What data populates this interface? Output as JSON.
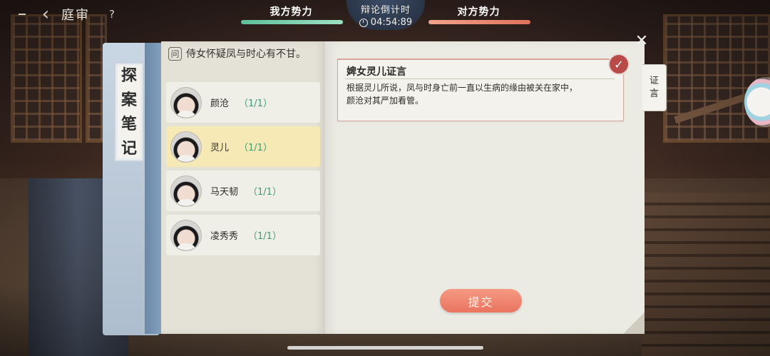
{
  "nav": {
    "page_title": "庭审",
    "help_label": "?"
  },
  "debate": {
    "our_side": "我方势力",
    "their_side": "对方势力",
    "timer_label": "辩论倒计时",
    "timer_value": "04:54:89",
    "colors": {
      "our_bar": "#6fcca6",
      "their_bar": "#e8826a"
    }
  },
  "notebook": {
    "tag_chars": [
      "探",
      "案",
      "笔",
      "记"
    ],
    "question_icon": "问",
    "question_text": "侍女怀疑凤与时心有不甘。",
    "characters": [
      {
        "name": "颜沧",
        "count": "（1/1）",
        "selected": false
      },
      {
        "name": "灵儿",
        "count": "（1/1）",
        "selected": true
      },
      {
        "name": "马天韧",
        "count": "（1/1）",
        "selected": false
      },
      {
        "name": "凌秀秀",
        "count": "（1/1）",
        "selected": false
      }
    ],
    "evidence": {
      "title": "婢女灵儿证言",
      "line1": "根据灵儿所说，凤与时身亡前一直以生病的缘由被关在家中，",
      "line2": "颜沧对其严加看管。"
    },
    "side_tab": [
      "证",
      "言"
    ],
    "submit_label": "提交"
  },
  "icons": {
    "back": "back-arrow-icon",
    "help": "help-icon",
    "clock": "clock-icon",
    "close": "close-icon",
    "check": "check-badge-icon"
  }
}
